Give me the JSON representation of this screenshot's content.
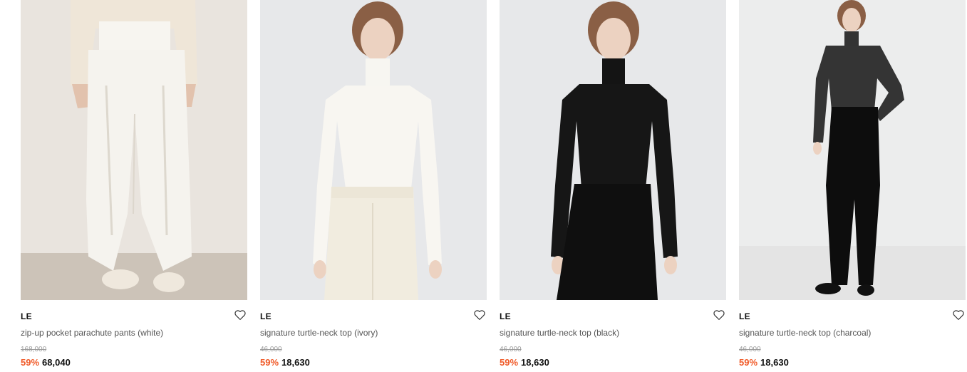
{
  "products": [
    {
      "brand": "LE",
      "name": "zip-up pocket parachute pants (white)",
      "original_price": "168,000",
      "discount": "59%",
      "price": "68,040"
    },
    {
      "brand": "LE",
      "name": "signature turtle-neck top (ivory)",
      "original_price": "46,000",
      "discount": "59%",
      "price": "18,630"
    },
    {
      "brand": "LE",
      "name": "signature turtle-neck top (black)",
      "original_price": "46,000",
      "discount": "59%",
      "price": "18,630"
    },
    {
      "brand": "LE",
      "name": "signature turtle-neck top (charcoal)",
      "original_price": "46,000",
      "discount": "59%",
      "price": "18,630"
    }
  ],
  "colors": {
    "discount": "#f05a28",
    "price": "#111111",
    "original_price": "#999999"
  },
  "icons": {
    "wishlist": "heart-outline-icon"
  }
}
